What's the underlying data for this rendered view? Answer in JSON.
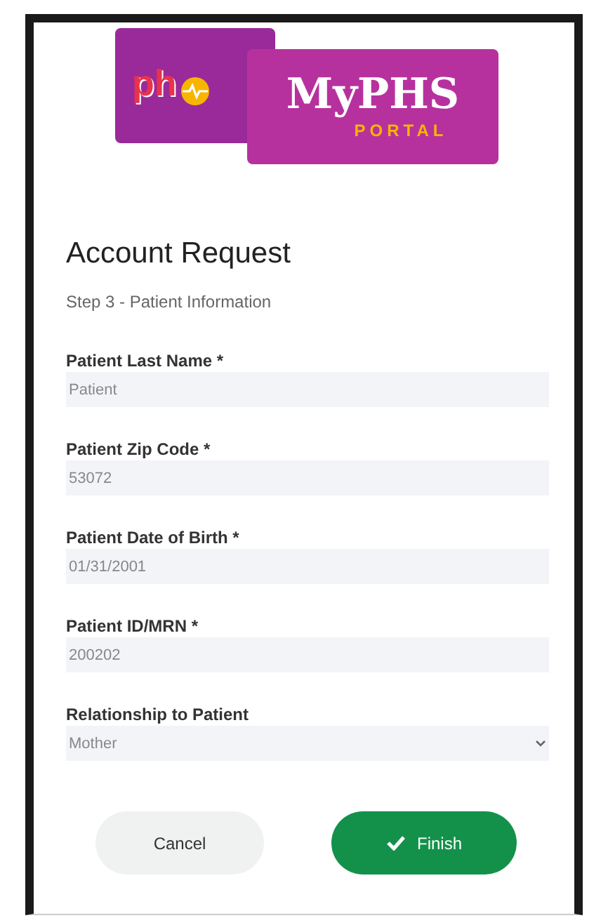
{
  "logo": {
    "mark": "ph",
    "title": "MyPHS",
    "subtitle": "PORTAL"
  },
  "heading": "Account Request",
  "step": "Step 3 - Patient Information",
  "fields": [
    {
      "label": "Patient Last Name *",
      "value": "Patient",
      "kind": "text"
    },
    {
      "label": "Patient Zip Code *",
      "value": "53072",
      "kind": "text"
    },
    {
      "label": "Patient Date of Birth *",
      "value": "01/31/2001",
      "kind": "text"
    },
    {
      "label": "Patient ID/MRN *",
      "value": "200202",
      "kind": "text"
    },
    {
      "label": "Relationship to Patient",
      "value": "Mother",
      "kind": "select"
    }
  ],
  "buttons": [
    {
      "label": "Cancel",
      "kind": "secondary"
    },
    {
      "label": "Finish",
      "kind": "primary"
    }
  ]
}
